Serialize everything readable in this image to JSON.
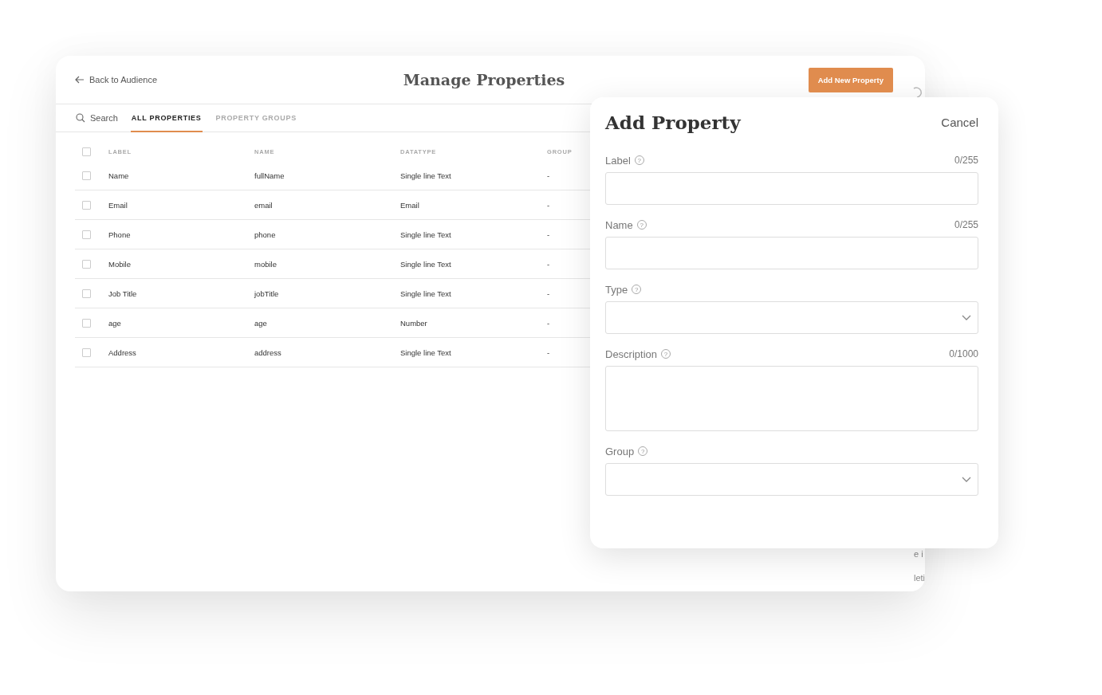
{
  "header": {
    "back_link": "Back to Audience",
    "title": "Manage Properties",
    "primary_button": "Add New Property"
  },
  "toolbar": {
    "search": "Search",
    "tabs": [
      {
        "label": "ALL PROPERTIES",
        "selected": true
      },
      {
        "label": "PROPERTY GROUPS",
        "selected": false
      }
    ]
  },
  "table": {
    "all_selected": false,
    "columns": [
      "LABEL",
      "NAME",
      "DATATYPE",
      "GROUP"
    ],
    "rows": [
      {
        "selected": false,
        "cells": [
          "Name",
          "fullName",
          "Single line Text",
          "-"
        ]
      },
      {
        "selected": false,
        "cells": [
          "Email",
          "email",
          "Email",
          "-"
        ]
      },
      {
        "selected": false,
        "cells": [
          "Phone",
          "phone",
          "Single line Text",
          "-"
        ]
      },
      {
        "selected": false,
        "cells": [
          "Mobile",
          "mobile",
          "Single line Text",
          "-"
        ]
      },
      {
        "selected": false,
        "cells": [
          "Job Title",
          "jobTitle",
          "Single line Text",
          "-"
        ]
      },
      {
        "selected": false,
        "cells": [
          "age",
          "age",
          "Number",
          "-"
        ]
      },
      {
        "selected": false,
        "cells": [
          "Address",
          "address",
          "Single line Text",
          "-"
        ]
      }
    ]
  },
  "partial_texts": [
    "e i",
    "leti"
  ],
  "modal": {
    "title": "Add Property",
    "cancel": "Cancel",
    "fields": [
      {
        "kind": "text",
        "label": "Label",
        "help": "?",
        "counter": "0/255"
      },
      {
        "kind": "text",
        "label": "Name",
        "help": "?",
        "counter": "0/255"
      },
      {
        "kind": "select",
        "label": "Type",
        "help": "?"
      },
      {
        "kind": "textarea",
        "label": "Description",
        "help": "?",
        "counter": "0/1000"
      },
      {
        "kind": "select",
        "label": "Group",
        "help": "?"
      }
    ]
  }
}
